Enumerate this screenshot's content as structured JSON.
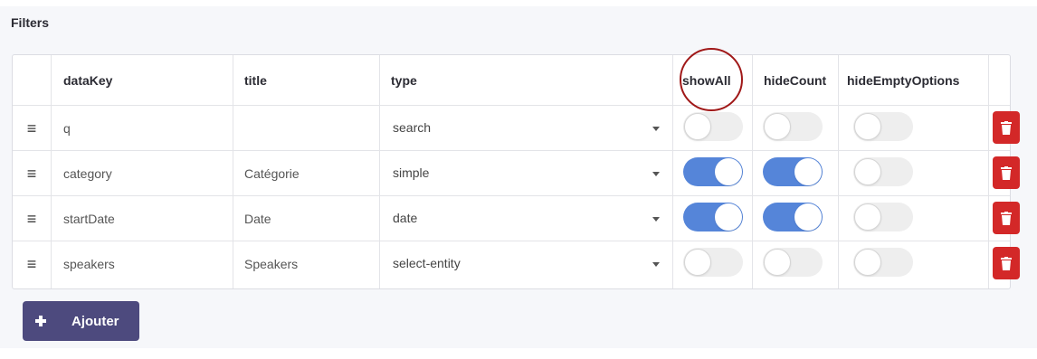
{
  "section": {
    "title": "Filters"
  },
  "table": {
    "headers": {
      "dataKey": "dataKey",
      "title": "title",
      "type": "type",
      "showAll": "showAll",
      "hideCount": "hideCount",
      "hideEmptyOptions": "hideEmptyOptions"
    },
    "rows": [
      {
        "dataKey": "q",
        "title": "",
        "type": "search",
        "showAll": false,
        "hideCount": false,
        "hideEmptyOptions": false
      },
      {
        "dataKey": "category",
        "title": "Catégorie",
        "type": "simple",
        "showAll": true,
        "hideCount": true,
        "hideEmptyOptions": false
      },
      {
        "dataKey": "startDate",
        "title": "Date",
        "type": "date",
        "showAll": true,
        "hideCount": true,
        "hideEmptyOptions": false
      },
      {
        "dataKey": "speakers",
        "title": "Speakers",
        "type": "select-entity",
        "showAll": false,
        "hideCount": false,
        "hideEmptyOptions": false
      }
    ],
    "drag_icon": "≡"
  },
  "actions": {
    "add_label": "Ajouter"
  },
  "colors": {
    "toggle_on": "#5585d9",
    "toggle_off": "#eeeeee",
    "delete": "#d32828",
    "add_button": "#4d4a7e",
    "annotation": "#a01818"
  }
}
